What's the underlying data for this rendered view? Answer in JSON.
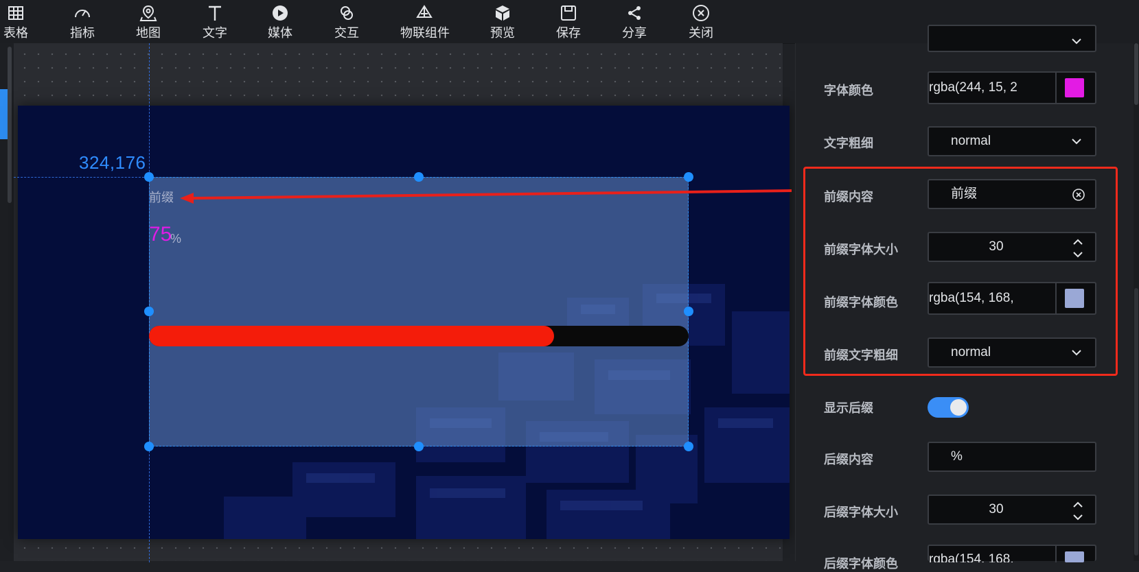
{
  "toolbar": {
    "items": [
      {
        "label": "表格",
        "icon": "table-icon"
      },
      {
        "label": "指标",
        "icon": "gauge-icon"
      },
      {
        "label": "地图",
        "icon": "map-pin-icon"
      },
      {
        "label": "文字",
        "icon": "text-icon"
      },
      {
        "label": "媒体",
        "icon": "play-icon"
      },
      {
        "label": "交互",
        "icon": "link-icon"
      },
      {
        "label": "物联组件",
        "icon": "iot-icon"
      },
      {
        "label": "预览",
        "icon": "cube-icon"
      },
      {
        "label": "保存",
        "icon": "save-icon"
      },
      {
        "label": "分享",
        "icon": "share-icon"
      },
      {
        "label": "关闭",
        "icon": "close-icon"
      }
    ]
  },
  "canvas": {
    "coordinates": "324,176",
    "widget": {
      "prefix": "前缀",
      "value": "75",
      "suffix": "%",
      "progress": 0.75,
      "value_color": "#e01be6",
      "bar_color": "#f41c0a",
      "track_color": "#0a0a0a"
    }
  },
  "panel": {
    "font_color": {
      "label": "字体颜色",
      "value": "rgba(244, 15, 2",
      "swatch": "#e31be4"
    },
    "font_weight": {
      "label": "文字粗细",
      "value": "normal"
    },
    "prefix_content": {
      "label": "前缀内容",
      "value": "前缀"
    },
    "prefix_font_size": {
      "label": "前缀字体大小",
      "value": "30"
    },
    "prefix_font_color": {
      "label": "前缀字体颜色",
      "value": "rgba(154, 168,",
      "swatch": "#9aa8d6"
    },
    "prefix_font_weight": {
      "label": "前缀文字粗细",
      "value": "normal"
    },
    "show_suffix": {
      "label": "显示后缀",
      "enabled": true
    },
    "suffix_content": {
      "label": "后缀内容",
      "value": "%"
    },
    "suffix_font_size": {
      "label": "后缀字体大小",
      "value": "30"
    },
    "suffix_font_color": {
      "label": "后缀字体颜色",
      "value": "rgba(154, 168,",
      "swatch": "#9aa8d6"
    }
  }
}
